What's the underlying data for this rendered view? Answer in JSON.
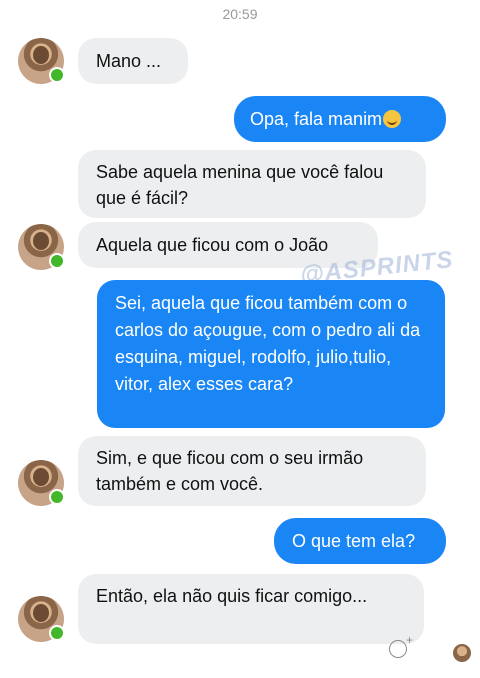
{
  "status": {
    "time": "20:59"
  },
  "watermark": "@ASPRINTS",
  "icons": {
    "contact_avatar": "contact-avatar",
    "online_indicator": "online-dot",
    "laughing_emoji": "laughing-emoji",
    "add_reaction": "add-reaction-icon",
    "seen_avatar": "seen-avatar"
  },
  "colors": {
    "outgoing_bubble": "#1a86f5",
    "incoming_bubble": "#eceef0",
    "online": "#42b72a"
  },
  "messages": [
    {
      "from": "them",
      "text": "Mano ..."
    },
    {
      "from": "me",
      "text": "Opa, fala manim"
    },
    {
      "from": "them",
      "text": "Sabe aquela menina que você falou que é fácil?"
    },
    {
      "from": "them",
      "text": "Aquela que ficou com o João"
    },
    {
      "from": "me",
      "text": "Sei, aquela que ficou também com o carlos do açougue, com o pedro ali da esquina, miguel, rodolfo, julio,tulio, vitor, alex esses cara?"
    },
    {
      "from": "them",
      "text": "Sim, e que ficou com o seu irmão também e com você."
    },
    {
      "from": "me",
      "text": "O que tem ela?"
    },
    {
      "from": "them",
      "text": "Então, ela não quis ficar comigo..."
    }
  ]
}
